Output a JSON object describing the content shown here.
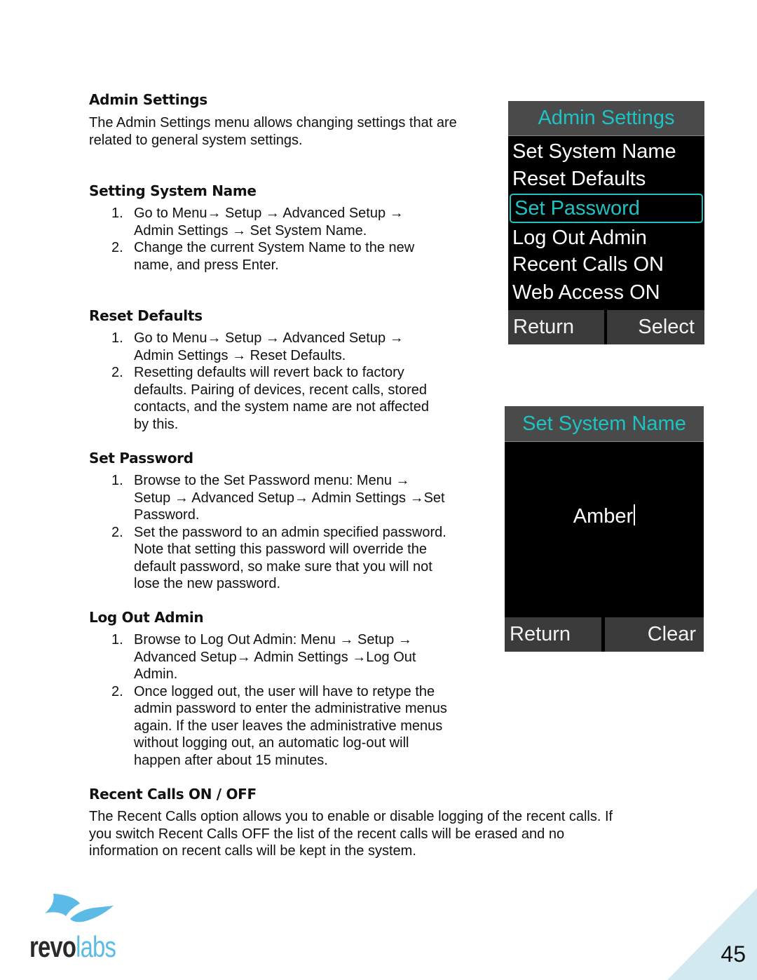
{
  "sections": {
    "admin_settings": {
      "heading": "Admin Settings",
      "lines": [
        "The Admin Settings menu allows changing settings that are",
        "related to general system settings."
      ]
    },
    "setting_system_name": {
      "heading": "Setting System Name",
      "steps": [
        {
          "num": "1.",
          "lines": [
            "Go to Menu→ Setup → Advanced Setup →",
            "Admin Settings → Set System Name."
          ]
        },
        {
          "num": "2.",
          "lines": [
            "Change the current System Name to the new",
            "name, and press Enter."
          ]
        }
      ]
    },
    "reset_defaults": {
      "heading": "Reset Defaults",
      "steps": [
        {
          "num": "1.",
          "lines": [
            "Go to Menu→ Setup → Advanced Setup →",
            "Admin Settings → Reset Defaults."
          ]
        },
        {
          "num": "2.",
          "lines": [
            "Resetting defaults will revert back to factory",
            "defaults.  Pairing of devices, recent calls, stored",
            "contacts, and the system name are not affected",
            "by this."
          ]
        }
      ]
    },
    "set_password": {
      "heading": "Set Password",
      "steps": [
        {
          "num": "1.",
          "lines": [
            "Browse to the Set Password menu: Menu →",
            "Setup → Advanced Setup→ Admin Settings →Set",
            "Password."
          ]
        },
        {
          "num": "2.",
          "lines": [
            "Set the password to an admin specified password.",
            "Note that setting this password will override the",
            "default password, so make sure that you will not",
            "lose the new password."
          ]
        }
      ]
    },
    "log_out_admin": {
      "heading": "Log Out Admin",
      "steps": [
        {
          "num": "1.",
          "lines": [
            "Browse to Log Out Admin: Menu → Setup →",
            "Advanced Setup→ Admin Settings →Log Out",
            "Admin."
          ]
        },
        {
          "num": "2.",
          "lines": [
            "Once logged out, the user will have to retype the",
            "admin password to enter the administrative menus",
            "again.  If the user leaves the administrative menus",
            "without logging out, an automatic log-out will",
            "happen after about 15 minutes."
          ]
        }
      ]
    },
    "recent_calls": {
      "heading": "Recent Calls ON / OFF",
      "lines": [
        "The Recent Calls option allows you to enable or disable logging of the recent calls.  If",
        "you switch Recent Calls OFF the list of the recent calls will be erased and no",
        "information on recent calls will be kept in the system."
      ]
    }
  },
  "screen_admin": {
    "title": "Admin Settings",
    "items": [
      "Set System Name",
      "Reset Defaults",
      "Set Password",
      "Log Out Admin",
      "Recent Calls ON",
      "Web Access ON"
    ],
    "selected_index": 2,
    "softkey_left": "Return",
    "softkey_right": "Select"
  },
  "screen_name": {
    "title": "Set System Name",
    "value": "Amber",
    "softkey_left": "Return",
    "softkey_right": "Clear"
  },
  "colors": {
    "accent": "#1fc2c2",
    "brand_blue": "#5bbbe6",
    "corner": "#d3e9f1"
  },
  "footer": {
    "logo_dark": "revo",
    "logo_light": "labs",
    "page_number": "45"
  }
}
